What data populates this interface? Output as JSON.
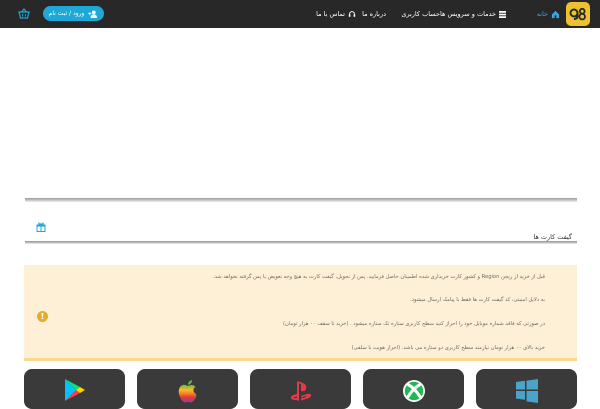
{
  "header": {
    "brand_logo": "g8-logo",
    "nav": [
      {
        "label": "خانه",
        "icon": "home-icon"
      },
      {
        "label": "خدمات و سرویس ها",
        "icon": "list-icon"
      },
      {
        "label": "حساب کاربری"
      },
      {
        "label": "درباره ما"
      },
      {
        "label": "تماس با ما",
        "icon": "headset-icon"
      }
    ],
    "login_label": "ورود / ثبت نام",
    "colors": {
      "bar": "#282828",
      "accent": "#1ea8d8",
      "logo": "#ecc233"
    }
  },
  "gift_section": {
    "title": "گیفت کارت ها",
    "icon": "gift-icon"
  },
  "notice": {
    "icon": "info-icon",
    "lines": [
      "قبل از خرید از ریجن Region و کشور کارت خریداری شده اطمینان حاصل فرمایید. پس از تحویل، گیفت کارت به هیچ وجه تعویض یا پس گرفته نخواهد شد.",
      "به دلایل امنیتی، کد گیفت کارت ها فقط با پیامک ارسال میشود.",
      "در صورتی که فاقد شماره موبایل خود را احراز کنید سطح کاربری ستاره تک ستاره میشود . (خرید تا سقف ۰۰ هزار تومان)",
      "خرید بالای ۰۰ هزار تومان نیازمند سطح کاربری دو ستاره می باشد. (احراز هویت با سلفی)"
    ]
  },
  "cards": [
    {
      "name": "google-play-icon"
    },
    {
      "name": "apple-icon"
    },
    {
      "name": "playstation-icon"
    },
    {
      "name": "xbox-icon"
    },
    {
      "name": "windows-icon"
    }
  ]
}
